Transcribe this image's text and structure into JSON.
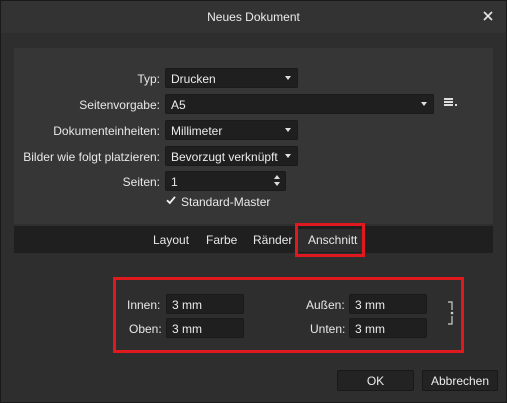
{
  "window": {
    "title": "Neues Dokument"
  },
  "form": {
    "typ": {
      "label": "Typ:",
      "value": "Drucken"
    },
    "seitenvorgabe": {
      "label": "Seitenvorgabe:",
      "value": "A5"
    },
    "einheiten": {
      "label": "Dokumenteinheiten:",
      "value": "Millimeter"
    },
    "bilder": {
      "label": "Bilder wie folgt platzieren:",
      "value": "Bevorzugt verknüpft"
    },
    "seiten": {
      "label": "Seiten:",
      "value": "1"
    },
    "standard_master": {
      "label": "Standard-Master",
      "checked": true
    }
  },
  "tabs": [
    {
      "label": "Layout",
      "active": false
    },
    {
      "label": "Farbe",
      "active": false
    },
    {
      "label": "Ränder",
      "active": false
    },
    {
      "label": "Anschnitt",
      "active": true
    }
  ],
  "bleed": {
    "innen": {
      "label": "Innen:",
      "value": "3 mm"
    },
    "oben": {
      "label": "Oben:",
      "value": "3 mm"
    },
    "aussen": {
      "label": "Außen:",
      "value": "3 mm"
    },
    "unten": {
      "label": "Unten:",
      "value": "3 mm"
    }
  },
  "buttons": {
    "ok": "OK",
    "cancel": "Abbrechen"
  },
  "icons": {
    "close": "close-icon",
    "preset_menu": "menu-icon",
    "link": "link-icon"
  },
  "colors": {
    "highlight": "#e0191f",
    "background": "#2e2e2e",
    "panel": "#363636",
    "field": "#1f1f1f"
  }
}
